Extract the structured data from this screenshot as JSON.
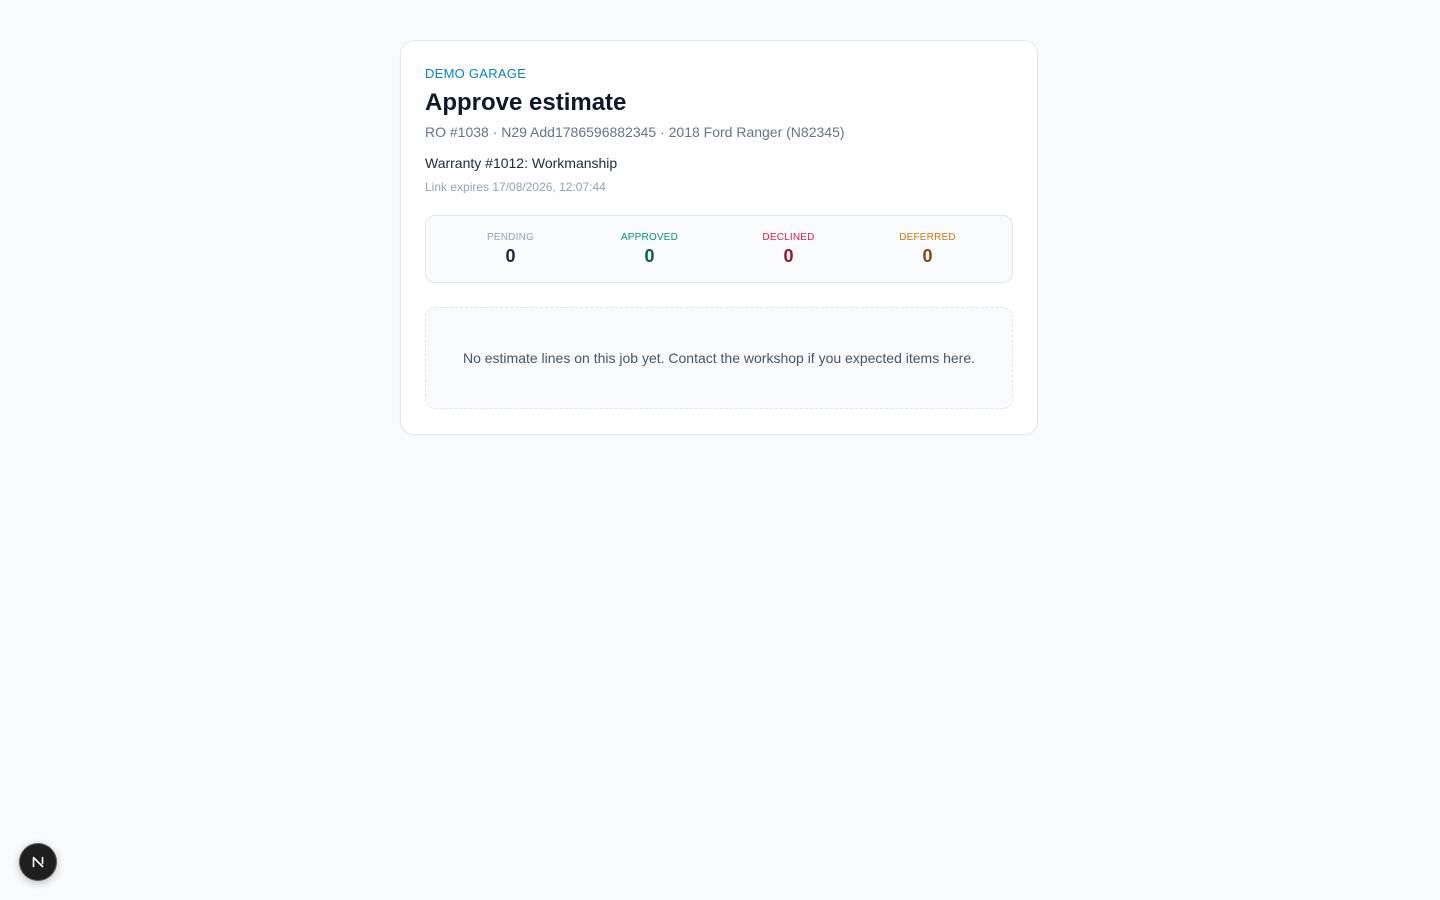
{
  "header": {
    "garage_name": "DEMO GARAGE",
    "title": "Approve estimate",
    "subtitle": "RO #1038 · N29 Add1786596882345 · 2018 Ford Ranger (N82345)",
    "warranty": "Warranty #1012: Workmanship",
    "expires": "Link expires 17/08/2026, 12:07:44"
  },
  "stats": [
    {
      "label": "PENDING",
      "value": "0",
      "label_color": "#94a3b8",
      "value_color": "#1e293b"
    },
    {
      "label": "APPROVED",
      "value": "0",
      "label_color": "#059669",
      "value_color": "#065f46"
    },
    {
      "label": "DECLINED",
      "value": "0",
      "label_color": "#e11d48",
      "value_color": "#9f1239"
    },
    {
      "label": "DEFERRED",
      "value": "0",
      "label_color": "#d97706",
      "value_color": "#92400e"
    }
  ],
  "empty_state": {
    "message": "No estimate lines on this job yet. Contact the workshop if you expected items here."
  },
  "devtools": {
    "icon": "nextjs-logo-icon"
  }
}
